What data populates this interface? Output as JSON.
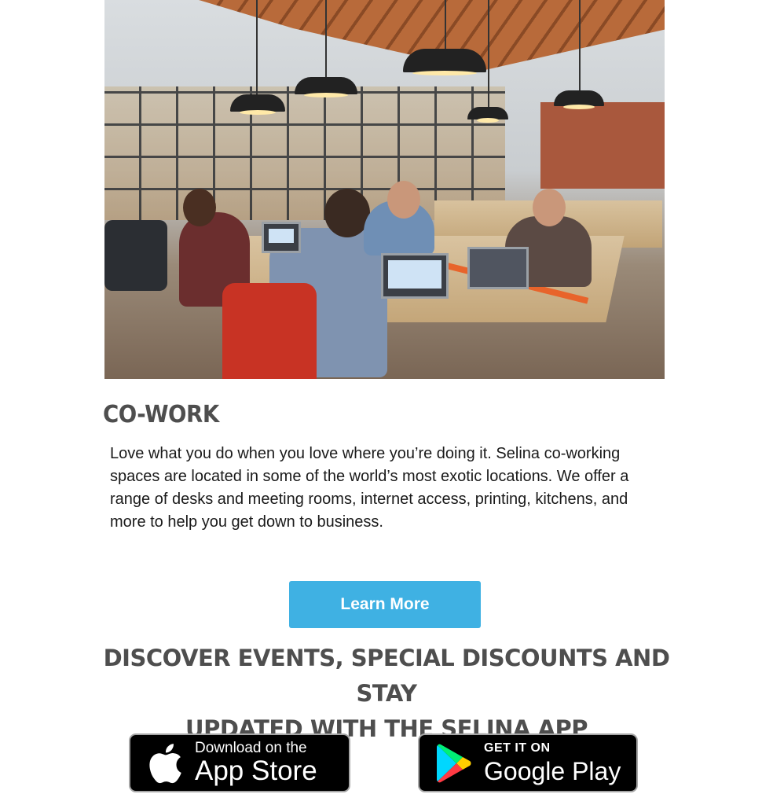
{
  "section": {
    "title": "CO-WORK",
    "body": "Love what you do when you love where you’re doing it. Selina co-working spaces are located in some of the world’s most exotic locations. We offer a range of desks and meeting rooms, internet access, printing, kitchens, and more to help you get down to business."
  },
  "cta": {
    "label": "Learn More",
    "color": "#3fb1e3"
  },
  "promo": {
    "line1": "DISCOVER EVENTS, SPECIAL DISCOUNTS AND STAY",
    "line2": "UPDATED WITH THE SELINA APP"
  },
  "badges": {
    "app_store": {
      "small": "Download on the",
      "big": "App Store",
      "icon": "apple-icon"
    },
    "google_play": {
      "small": "GET IT ON",
      "big": "Google Play",
      "icon": "google-play-icon"
    }
  }
}
